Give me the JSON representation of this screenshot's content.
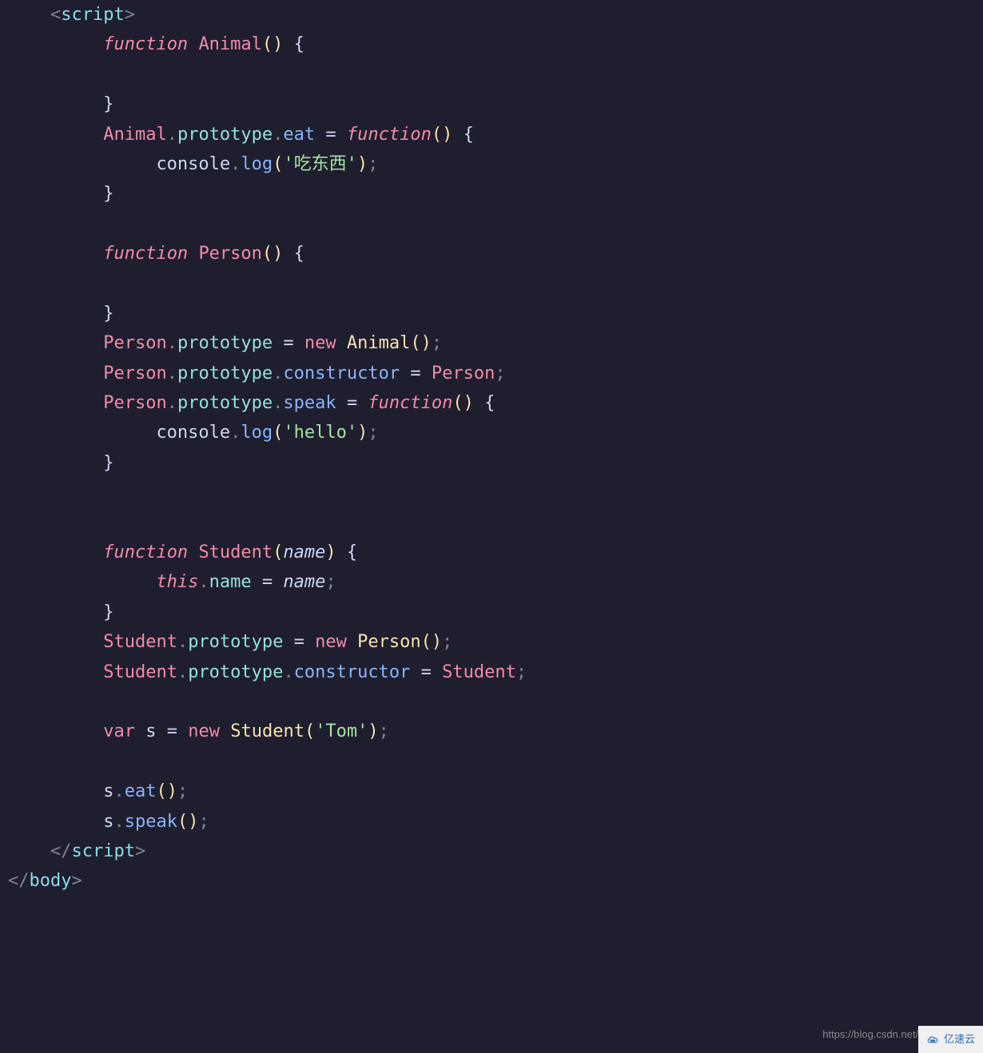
{
  "code": {
    "lines": [
      {
        "indent": 1,
        "tokens": [
          {
            "t": "angle",
            "v": "<"
          },
          {
            "t": "tag",
            "v": "script"
          },
          {
            "t": "angle",
            "v": ">"
          }
        ]
      },
      {
        "indent": 2,
        "tokens": [
          {
            "t": "keyword",
            "v": "function"
          },
          {
            "t": "plain",
            "v": " "
          },
          {
            "t": "function-def",
            "v": "Animal"
          },
          {
            "t": "paren",
            "v": "()"
          },
          {
            "t": "plain",
            "v": " "
          },
          {
            "t": "brace",
            "v": "{"
          }
        ]
      },
      {
        "indent": 2,
        "tokens": []
      },
      {
        "indent": 2,
        "tokens": [
          {
            "t": "brace",
            "v": "}"
          }
        ]
      },
      {
        "indent": 2,
        "tokens": [
          {
            "t": "class-name",
            "v": "Animal"
          },
          {
            "t": "punct",
            "v": "."
          },
          {
            "t": "prop-cyan",
            "v": "prototype"
          },
          {
            "t": "punct",
            "v": "."
          },
          {
            "t": "method",
            "v": "eat"
          },
          {
            "t": "plain",
            "v": " "
          },
          {
            "t": "operator",
            "v": "="
          },
          {
            "t": "plain",
            "v": " "
          },
          {
            "t": "keyword",
            "v": "function"
          },
          {
            "t": "paren",
            "v": "()"
          },
          {
            "t": "plain",
            "v": " "
          },
          {
            "t": "brace",
            "v": "{"
          }
        ]
      },
      {
        "indent": 3,
        "tokens": [
          {
            "t": "var-name",
            "v": "console"
          },
          {
            "t": "punct",
            "v": "."
          },
          {
            "t": "method-call",
            "v": "log"
          },
          {
            "t": "paren",
            "v": "("
          },
          {
            "t": "string",
            "v": "'吃东西'"
          },
          {
            "t": "paren",
            "v": ")"
          },
          {
            "t": "punct",
            "v": ";"
          }
        ]
      },
      {
        "indent": 2,
        "tokens": [
          {
            "t": "brace",
            "v": "}"
          }
        ]
      },
      {
        "indent": 0,
        "tokens": []
      },
      {
        "indent": 2,
        "tokens": [
          {
            "t": "keyword",
            "v": "function"
          },
          {
            "t": "plain",
            "v": " "
          },
          {
            "t": "function-def",
            "v": "Person"
          },
          {
            "t": "paren",
            "v": "()"
          },
          {
            "t": "plain",
            "v": " "
          },
          {
            "t": "brace",
            "v": "{"
          }
        ]
      },
      {
        "indent": 2,
        "tokens": []
      },
      {
        "indent": 2,
        "tokens": [
          {
            "t": "brace",
            "v": "}"
          }
        ]
      },
      {
        "indent": 2,
        "tokens": [
          {
            "t": "class-name",
            "v": "Person"
          },
          {
            "t": "punct",
            "v": "."
          },
          {
            "t": "prop-cyan",
            "v": "prototype"
          },
          {
            "t": "plain",
            "v": " "
          },
          {
            "t": "operator",
            "v": "="
          },
          {
            "t": "plain",
            "v": " "
          },
          {
            "t": "keyword-plain",
            "v": "new"
          },
          {
            "t": "plain",
            "v": " "
          },
          {
            "t": "function-name",
            "v": "Animal"
          },
          {
            "t": "paren",
            "v": "()"
          },
          {
            "t": "punct",
            "v": ";"
          }
        ]
      },
      {
        "indent": 2,
        "tokens": [
          {
            "t": "class-name",
            "v": "Person"
          },
          {
            "t": "punct",
            "v": "."
          },
          {
            "t": "prop-cyan",
            "v": "prototype"
          },
          {
            "t": "punct",
            "v": "."
          },
          {
            "t": "method",
            "v": "constructor"
          },
          {
            "t": "plain",
            "v": " "
          },
          {
            "t": "operator",
            "v": "="
          },
          {
            "t": "plain",
            "v": " "
          },
          {
            "t": "class-name",
            "v": "Person"
          },
          {
            "t": "punct",
            "v": ";"
          }
        ]
      },
      {
        "indent": 2,
        "tokens": [
          {
            "t": "class-name",
            "v": "Person"
          },
          {
            "t": "punct",
            "v": "."
          },
          {
            "t": "prop-cyan",
            "v": "prototype"
          },
          {
            "t": "punct",
            "v": "."
          },
          {
            "t": "method",
            "v": "speak"
          },
          {
            "t": "plain",
            "v": " "
          },
          {
            "t": "operator",
            "v": "="
          },
          {
            "t": "plain",
            "v": " "
          },
          {
            "t": "keyword",
            "v": "function"
          },
          {
            "t": "paren",
            "v": "()"
          },
          {
            "t": "plain",
            "v": " "
          },
          {
            "t": "brace",
            "v": "{"
          }
        ]
      },
      {
        "indent": 3,
        "tokens": [
          {
            "t": "var-name",
            "v": "console"
          },
          {
            "t": "punct",
            "v": "."
          },
          {
            "t": "method-call",
            "v": "log"
          },
          {
            "t": "paren",
            "v": "("
          },
          {
            "t": "string",
            "v": "'hello'"
          },
          {
            "t": "paren",
            "v": ")"
          },
          {
            "t": "punct",
            "v": ";"
          }
        ]
      },
      {
        "indent": 2,
        "tokens": [
          {
            "t": "brace",
            "v": "}"
          }
        ]
      },
      {
        "indent": 0,
        "tokens": []
      },
      {
        "indent": 0,
        "tokens": []
      },
      {
        "indent": 2,
        "tokens": [
          {
            "t": "keyword",
            "v": "function"
          },
          {
            "t": "plain",
            "v": " "
          },
          {
            "t": "function-def",
            "v": "Student"
          },
          {
            "t": "paren",
            "v": "("
          },
          {
            "t": "param",
            "v": "name"
          },
          {
            "t": "paren",
            "v": ")"
          },
          {
            "t": "plain",
            "v": " "
          },
          {
            "t": "brace",
            "v": "{"
          }
        ]
      },
      {
        "indent": 3,
        "tokens": [
          {
            "t": "this",
            "v": "this"
          },
          {
            "t": "punct",
            "v": "."
          },
          {
            "t": "prop-cyan",
            "v": "name"
          },
          {
            "t": "plain",
            "v": " "
          },
          {
            "t": "operator",
            "v": "="
          },
          {
            "t": "plain",
            "v": " "
          },
          {
            "t": "param",
            "v": "name"
          },
          {
            "t": "punct",
            "v": ";"
          }
        ]
      },
      {
        "indent": 2,
        "tokens": [
          {
            "t": "brace",
            "v": "}"
          }
        ]
      },
      {
        "indent": 2,
        "tokens": [
          {
            "t": "class-name",
            "v": "Student"
          },
          {
            "t": "punct",
            "v": "."
          },
          {
            "t": "prop-cyan",
            "v": "prototype"
          },
          {
            "t": "plain",
            "v": " "
          },
          {
            "t": "operator",
            "v": "="
          },
          {
            "t": "plain",
            "v": " "
          },
          {
            "t": "keyword-plain",
            "v": "new"
          },
          {
            "t": "plain",
            "v": " "
          },
          {
            "t": "function-name",
            "v": "Person"
          },
          {
            "t": "paren",
            "v": "()"
          },
          {
            "t": "punct",
            "v": ";"
          }
        ]
      },
      {
        "indent": 2,
        "tokens": [
          {
            "t": "class-name",
            "v": "Student"
          },
          {
            "t": "punct",
            "v": "."
          },
          {
            "t": "prop-cyan",
            "v": "prototype"
          },
          {
            "t": "punct",
            "v": "."
          },
          {
            "t": "method",
            "v": "constructor"
          },
          {
            "t": "plain",
            "v": " "
          },
          {
            "t": "operator",
            "v": "="
          },
          {
            "t": "plain",
            "v": " "
          },
          {
            "t": "class-name",
            "v": "Student"
          },
          {
            "t": "punct",
            "v": ";"
          }
        ]
      },
      {
        "indent": 0,
        "tokens": []
      },
      {
        "indent": 2,
        "tokens": [
          {
            "t": "keyword-plain",
            "v": "var"
          },
          {
            "t": "plain",
            "v": " "
          },
          {
            "t": "var-name",
            "v": "s"
          },
          {
            "t": "plain",
            "v": " "
          },
          {
            "t": "operator",
            "v": "="
          },
          {
            "t": "plain",
            "v": " "
          },
          {
            "t": "keyword-plain",
            "v": "new"
          },
          {
            "t": "plain",
            "v": " "
          },
          {
            "t": "function-name",
            "v": "Student"
          },
          {
            "t": "paren",
            "v": "("
          },
          {
            "t": "string",
            "v": "'Tom'"
          },
          {
            "t": "paren",
            "v": ")"
          },
          {
            "t": "punct",
            "v": ";"
          }
        ]
      },
      {
        "indent": 0,
        "tokens": []
      },
      {
        "indent": 2,
        "tokens": [
          {
            "t": "var-name",
            "v": "s"
          },
          {
            "t": "punct",
            "v": "."
          },
          {
            "t": "method-call",
            "v": "eat"
          },
          {
            "t": "paren",
            "v": "()"
          },
          {
            "t": "punct",
            "v": ";"
          }
        ]
      },
      {
        "indent": 2,
        "tokens": [
          {
            "t": "var-name",
            "v": "s"
          },
          {
            "t": "punct",
            "v": "."
          },
          {
            "t": "method-call",
            "v": "speak"
          },
          {
            "t": "paren",
            "v": "()"
          },
          {
            "t": "punct",
            "v": ";"
          }
        ]
      },
      {
        "indent": 1,
        "tokens": [
          {
            "t": "angle",
            "v": "</"
          },
          {
            "t": "tag",
            "v": "script"
          },
          {
            "t": "angle",
            "v": ">"
          }
        ]
      },
      {
        "indent": 0,
        "tokens": [
          {
            "t": "angle",
            "v": "</"
          },
          {
            "t": "tag",
            "v": "body"
          },
          {
            "t": "angle",
            "v": ">"
          }
        ]
      }
    ]
  },
  "watermark": {
    "url": "https://blog.csdn.net/m",
    "brand": "亿速云"
  },
  "indent_unit": "    ",
  "indent_base": "    ",
  "colors": {
    "tag": "#89dceb",
    "angle": "#7f849c",
    "keyword": "#f38ba8",
    "function-name": "#f9e2af",
    "function-def": "#f38ba8",
    "class-name": "#f38ba8",
    "paren": "#f9e2af",
    "brace": "#cdd6f4",
    "punct": "#7f849c",
    "method": "#89b4fa",
    "method-call": "#89b4fa",
    "prop-cyan": "#94e2d5",
    "string": "#a6e3a1",
    "param": "#cdd6f4",
    "this": "#f38ba8",
    "var-name": "#cdd6f4",
    "operator": "#cdd6f4",
    "plain": "#cdd6f4"
  }
}
